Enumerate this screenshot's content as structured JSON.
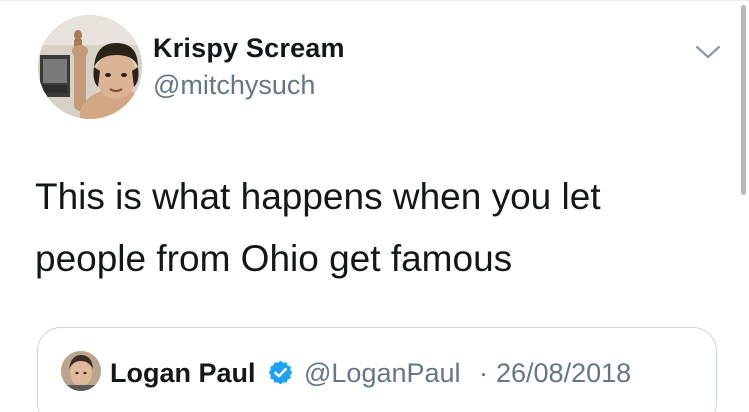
{
  "tweet": {
    "author": {
      "display_name": "Krispy Scream",
      "handle": "@mitchysuch",
      "avatar_icon": "avatar"
    },
    "menu_icon": "chevron-down-icon",
    "text_lines": [
      "This is what happens when you let",
      "people from Ohio get famous"
    ]
  },
  "quoted_tweet": {
    "author": {
      "display_name": "Logan Paul",
      "verified_icon": "verified-badge-icon",
      "handle": "@LoganPaul",
      "separator": "·",
      "date": "26/08/2018"
    }
  },
  "colors": {
    "primary_text": "#14171a",
    "secondary_text": "#657786",
    "verified_blue": "#1da1f2",
    "border": "#ccd6dd",
    "background": "#ffffff"
  }
}
